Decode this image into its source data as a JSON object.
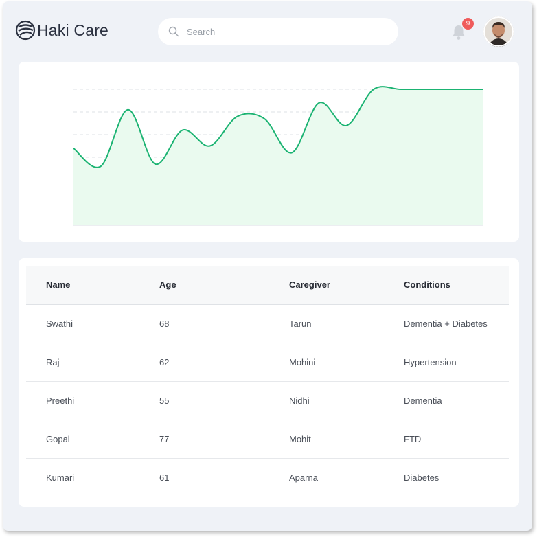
{
  "app": {
    "name": "Haki Care"
  },
  "header": {
    "search_placeholder": "Search",
    "notification_count": "9"
  },
  "chart_data": {
    "type": "area",
    "title": "",
    "xlabel": "",
    "ylabel": "",
    "color": "#1bb372",
    "fill": "#eafaef",
    "grid": true,
    "ylim": [
      0,
      6
    ],
    "x": [
      0,
      1,
      2,
      3,
      4,
      5,
      6,
      7,
      8,
      9,
      10,
      11,
      12,
      13,
      14,
      15
    ],
    "y": [
      3.4,
      2.6,
      5.1,
      2.7,
      4.2,
      3.5,
      4.8,
      4.7,
      3.2,
      5.4,
      4.4,
      6.0,
      6.0,
      6.0,
      6.0,
      6.0
    ]
  },
  "table": {
    "columns": [
      "Name",
      "Age",
      "Caregiver",
      "Conditions"
    ],
    "rows": [
      [
        "Swathi",
        "68",
        "Tarun",
        "Dementia + Diabetes"
      ],
      [
        "Raj",
        "62",
        "Mohini",
        "Hypertension"
      ],
      [
        "Preethi",
        "55",
        "Nidhi",
        "Dementia"
      ],
      [
        "Gopal",
        "77",
        "Mohit",
        "FTD"
      ],
      [
        "Kumari",
        "61",
        "Aparna",
        "Diabetes"
      ]
    ]
  }
}
